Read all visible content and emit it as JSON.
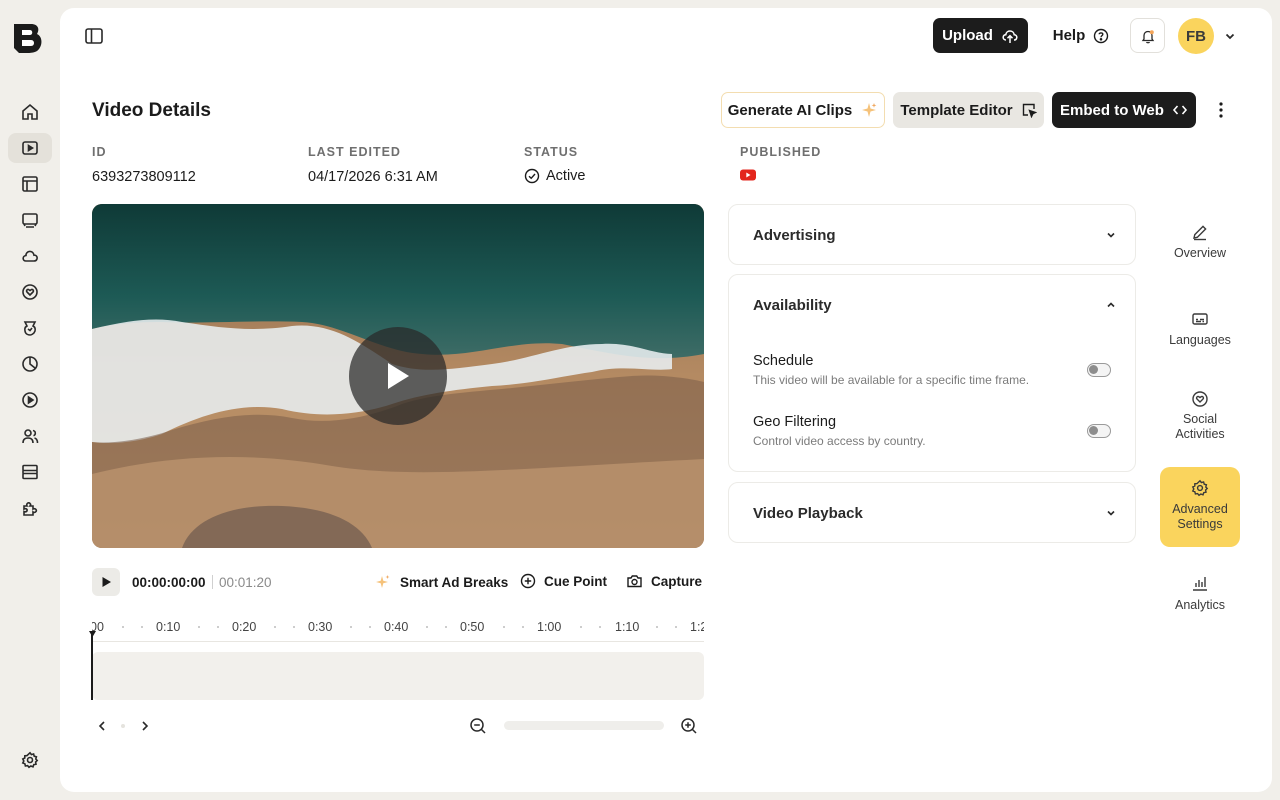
{
  "header": {
    "upload_label": "Upload",
    "help_label": "Help",
    "avatar_initials": "FB"
  },
  "page": {
    "title": "Video Details",
    "actions": {
      "generate_label": "Generate AI Clips",
      "template_label": "Template Editor",
      "embed_label": "Embed to Web"
    }
  },
  "meta": {
    "id_label": "ID",
    "id_value": "6393273809112",
    "edited_label": "LAST EDITED",
    "edited_value": "04/17/2026 6:31 AM",
    "status_label": "STATUS",
    "status_value": "Active",
    "published_label": "PUBLISHED",
    "published_icon": "youtube-icon"
  },
  "player": {
    "current_time": "00:00:00:00",
    "duration": "00:01:20",
    "smart_ad_label": "Smart Ad Breaks",
    "cue_point_label": "Cue Point",
    "capture_label": "Capture",
    "ticks": [
      "00",
      "0:10",
      "0:20",
      "0:30",
      "0:40",
      "0:50",
      "1:00",
      "1:10",
      "1:2"
    ]
  },
  "panels": {
    "advertising": "Advertising",
    "availability": "Availability",
    "schedule_title": "Schedule",
    "schedule_desc": "This video will be available for a specific time frame.",
    "geo_title": "Geo Filtering",
    "geo_desc": "Control video access by country.",
    "video_playback": "Video Playback"
  },
  "side_tabs": {
    "overview": "Overview",
    "languages": "Languages",
    "social_1": "Social",
    "social_2": "Activities",
    "advanced_1": "Advanced",
    "advanced_2": "Settings",
    "analytics": "Analytics"
  },
  "colors": {
    "accent": "#fad45d",
    "dark": "#1c1c1c",
    "youtube": "#e3261c"
  }
}
